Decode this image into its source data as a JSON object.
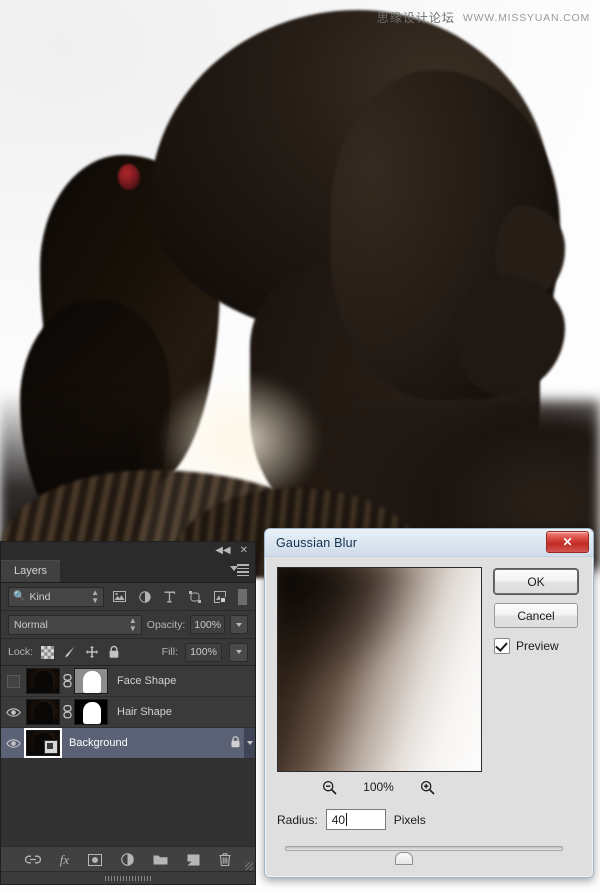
{
  "watermark": {
    "cn_text": "思缘设计论坛",
    "url_text": "WWW.MISSYUAN.COM"
  },
  "photo": {
    "alt": "dark silhouette profile of a woman with ponytail"
  },
  "layers_panel": {
    "tab_label": "Layers",
    "collapse_icon": "◀◀",
    "close_icon": "✕",
    "filter": {
      "kind_label": "Kind",
      "icons": [
        "pixel-layer-filter-icon",
        "adjustment-layer-filter-icon",
        "type-layer-filter-icon",
        "shape-layer-filter-icon",
        "smart-object-filter-icon"
      ],
      "toggle_name": "filter-enable-toggle"
    },
    "blend": {
      "mode": "Normal",
      "opacity_label": "Opacity:",
      "opacity_value": "100%"
    },
    "lock": {
      "label": "Lock:",
      "fill_label": "Fill:",
      "fill_value": "100%",
      "icons": [
        "lock-transparency-icon",
        "lock-image-icon",
        "lock-position-icon",
        "lock-all-icon"
      ]
    },
    "rows": [
      {
        "name": "Face Shape",
        "visible": false,
        "selected": false,
        "linked": true,
        "has_mask": true,
        "mask_kind": "grey"
      },
      {
        "name": "Hair Shape",
        "visible": true,
        "selected": false,
        "linked": true,
        "has_mask": true,
        "mask_kind": "black"
      },
      {
        "name": "Background",
        "visible": true,
        "selected": true,
        "linked": false,
        "has_mask": false,
        "locked_badge": "lock-icon"
      }
    ],
    "bottom_icons": [
      "link-layers-icon",
      "layer-style-fx-icon",
      "add-layer-mask-icon",
      "new-adjustment-layer-icon",
      "new-group-icon",
      "new-layer-icon",
      "delete-layer-icon"
    ],
    "fx_label": "fx"
  },
  "dialog": {
    "title": "Gaussian Blur",
    "close_label": "✕",
    "ok_label": "OK",
    "cancel_label": "Cancel",
    "preview_label": "Preview",
    "preview_checked": true,
    "zoom_out_icon": "zoom-out-icon",
    "zoom_in_icon": "zoom-in-icon",
    "zoom_value": "100%",
    "radius_label": "Radius:",
    "radius_value": "40",
    "radius_units": "Pixels",
    "slider_percent": 42
  },
  "colors": {
    "panel_bg": "#323232",
    "panel_row": "#3a3a3a",
    "selected_row": "#5b6275",
    "dialog_bg": "#dfdfdf",
    "title_blue": "#12304d",
    "close_red": "#c02c25"
  }
}
